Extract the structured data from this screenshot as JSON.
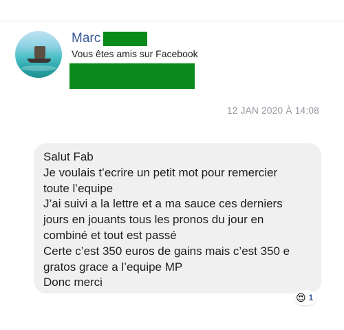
{
  "contact": {
    "first_name": "Marc",
    "friend_status": "Vous êtes amis sur Facebook"
  },
  "conversation": {
    "timestamp": "12 JAN 2020 À 14:08",
    "message": {
      "lines": [
        "Salut Fab",
        "Je voulais t’ecrire un petit mot pour remercier",
        "toute l’equipe",
        "J’ai suivi a la lettre et a ma sauce ces derniers",
        "jours en jouants tous les pronos du jour en",
        "combiné et tout est passé",
        "Certe c’est 350 euros de gains mais c’est 350 e",
        "gratos grace a l’equipe MP",
        "Donc merci"
      ]
    },
    "reaction": {
      "emoji": "😍",
      "icon": "heart-eyes-emoji-icon",
      "count": "1"
    }
  },
  "colors": {
    "name_blue": "#385898",
    "redaction_green": "#0a8a1a",
    "bubble_gray": "#f1f0f0",
    "timestamp_gray": "#90949c"
  }
}
